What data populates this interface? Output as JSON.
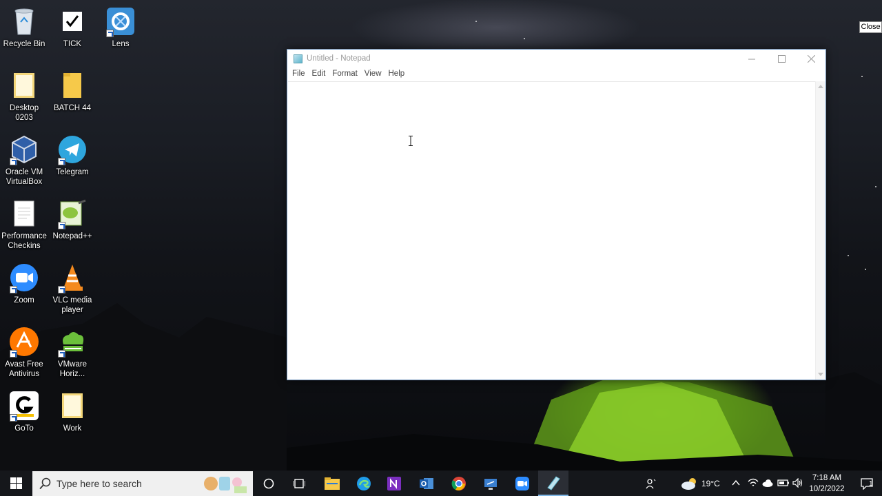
{
  "desktop": {
    "icons": [
      {
        "label": "Recycle Bin"
      },
      {
        "label": "TICK"
      },
      {
        "label": "Lens"
      },
      {
        "label": "Desktop 0203"
      },
      {
        "label": "BATCH 44"
      },
      {
        "label": "Oracle VM VirtualBox"
      },
      {
        "label": "Telegram"
      },
      {
        "label": "Performance Checkins"
      },
      {
        "label": "Notepad++"
      },
      {
        "label": "Zoom"
      },
      {
        "label": "VLC media player"
      },
      {
        "label": "Avast Free Antivirus"
      },
      {
        "label": "VMware Horiz..."
      },
      {
        "label": "GoTo"
      },
      {
        "label": "Work"
      }
    ],
    "tooltip": "Close"
  },
  "notepad": {
    "title": "Untitled - Notepad",
    "menu": [
      "File",
      "Edit",
      "Format",
      "View",
      "Help"
    ],
    "content": ""
  },
  "taskbar": {
    "search_placeholder": "Type here to search",
    "apps": [
      "File Explorer",
      "Microsoft Edge",
      "OneNote",
      "Outlook",
      "Google Chrome",
      "Remote Desktop",
      "Zoom",
      "Notepad"
    ],
    "weather": "19°C",
    "time": "7:18 AM",
    "date": "10/2/2022",
    "notification_count": "1"
  },
  "colors": {
    "taskbar_bg": "#15171b",
    "accent": "#7fb7e6",
    "titlebar_text": "#999999"
  }
}
